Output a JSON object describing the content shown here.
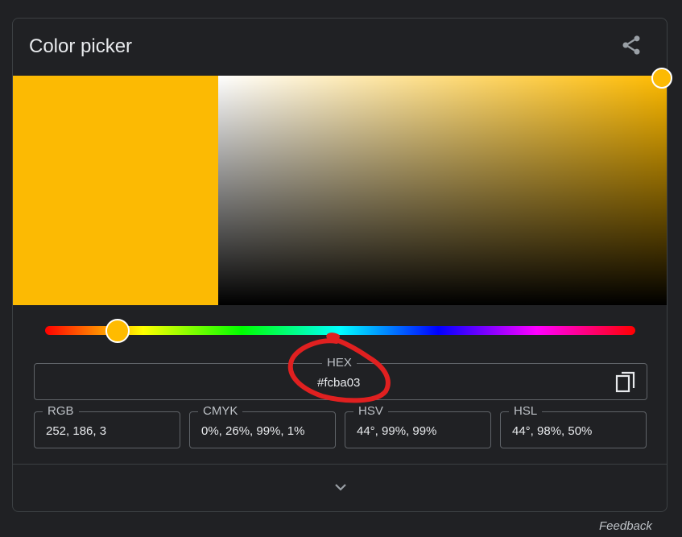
{
  "title": "Color picker",
  "selected_color": "#fcba03",
  "picker": {
    "hue_color": "#ffbb00",
    "saturation_level": 0.99,
    "value_level": 0.99,
    "hue_degrees": 44
  },
  "hex": {
    "label": "HEX",
    "value": "#fcba03"
  },
  "rgb": {
    "label": "RGB",
    "value": "252, 186, 3"
  },
  "cmyk": {
    "label": "CMYK",
    "value": " 0%, 26%, 99%, 1%"
  },
  "hsv": {
    "label": "HSV",
    "value": "44°, 99%, 99%"
  },
  "hsl": {
    "label": "HSL",
    "value": "44°, 98%, 50%"
  },
  "feedback": "Feedback",
  "icons": {
    "share": "share-icon",
    "copy": "copy-icon",
    "expand": "chevron-down-icon"
  },
  "annotation": {
    "color": "#e02020",
    "shape": "circle-around-hex"
  }
}
